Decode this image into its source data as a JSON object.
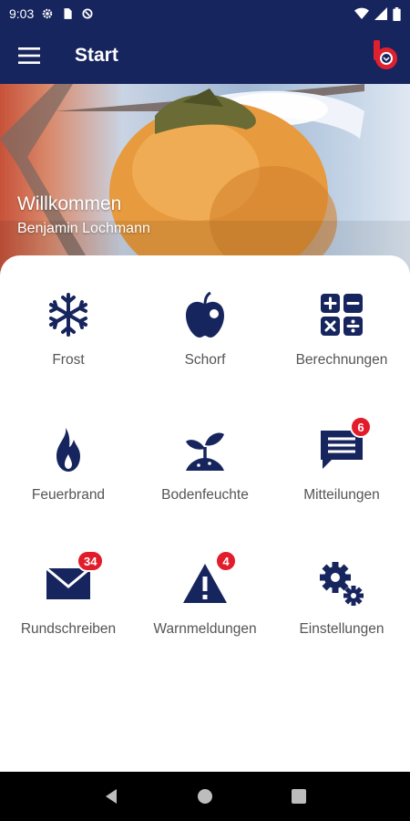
{
  "status_bar": {
    "time": "9:03"
  },
  "app_bar": {
    "title": "Start"
  },
  "hero": {
    "welcome": "Willkommen",
    "user": "Benjamin Lochmann"
  },
  "tiles": [
    {
      "label": "Frost",
      "icon": "snowflake-icon"
    },
    {
      "label": "Schorf",
      "icon": "apple-icon"
    },
    {
      "label": "Berechnungen",
      "icon": "calculator-icon"
    },
    {
      "label": "Feuerbrand",
      "icon": "flame-icon"
    },
    {
      "label": "Bodenfeuchte",
      "icon": "sprout-icon"
    },
    {
      "label": "Mitteilungen",
      "icon": "message-icon",
      "badge": "6"
    },
    {
      "label": "Rundschreiben",
      "icon": "envelope-icon",
      "badge": "34"
    },
    {
      "label": "Warnmeldungen",
      "icon": "warning-icon",
      "badge": "4"
    },
    {
      "label": "Einstellungen",
      "icon": "gears-icon"
    }
  ],
  "colors": {
    "primary": "#17255e",
    "badge": "#e21c2a",
    "label": "#555555"
  }
}
